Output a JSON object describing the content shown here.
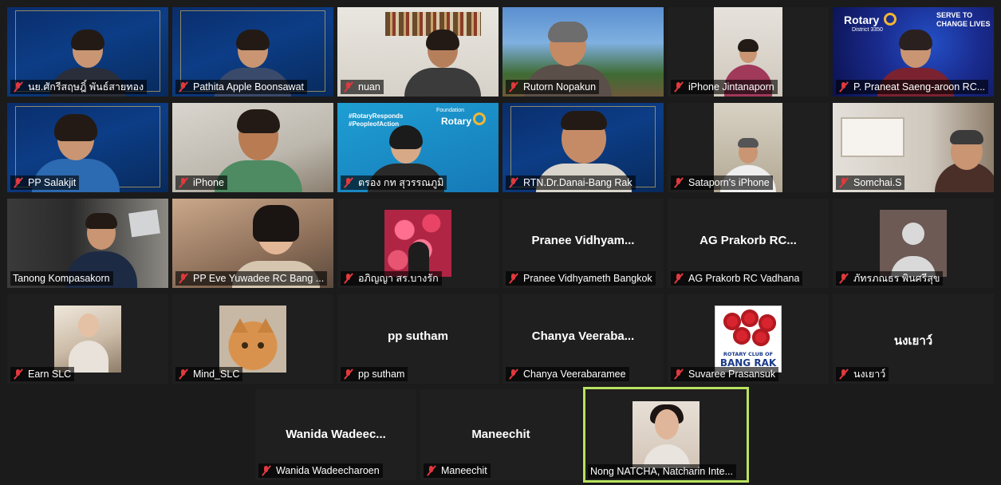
{
  "tiles": [
    {
      "name": "นย.ศักรีสฤษฎิ์ พันธ์สายทอง",
      "muted": true
    },
    {
      "name": "Pathita Apple Boonsawat",
      "muted": true
    },
    {
      "name": "nuan",
      "muted": true
    },
    {
      "name": "Rutorn Nopakun",
      "muted": true
    },
    {
      "name": "iPhone Jintanaporn",
      "muted": true
    },
    {
      "name": "P. Praneat Saeng-aroon RC...",
      "muted": true
    },
    {
      "name": "PP Salakjit",
      "muted": true
    },
    {
      "name": "iPhone",
      "muted": true
    },
    {
      "name": "ตรอง กท สุวรรณภูมิ",
      "muted": true
    },
    {
      "name": "RTN.Dr.Danai-Bang Rak",
      "muted": true
    },
    {
      "name": "Sataporn's iPhone",
      "muted": true
    },
    {
      "name": "Somchai.S",
      "muted": true
    },
    {
      "name": "Tanong Kompasakorn",
      "muted": false
    },
    {
      "name": "PP Eve Yuwadee RC Bang ...",
      "muted": true
    },
    {
      "name": "อภิญญา สร.บางรัก",
      "muted": true
    },
    {
      "name": "Pranee Vidhyameth Bangkok",
      "muted": true,
      "center": "Pranee  Vidhyam..."
    },
    {
      "name": "AG Prakorb RC Vadhana",
      "muted": true,
      "center": "AG  Prakorb  RC..."
    },
    {
      "name": "ภัทรภณธร พินศรีสุข",
      "muted": true
    },
    {
      "name": "Earn SLC",
      "muted": true
    },
    {
      "name": "Mind_SLC",
      "muted": true
    },
    {
      "name": "pp sutham",
      "muted": true,
      "center": "pp sutham"
    },
    {
      "name": "Chanya Veerabaramee",
      "muted": true,
      "center": "Chanya  Veeraba..."
    },
    {
      "name": "Suvaree Prasansuk",
      "muted": true
    },
    {
      "name": "นงเยาว์",
      "muted": true,
      "center": "นงเยาว์"
    },
    {
      "name": "Wanida Wadeecharoen",
      "muted": true,
      "center": "Wanida  Wadeec..."
    },
    {
      "name": "Maneechit",
      "muted": true,
      "center": "Maneechit"
    },
    {
      "name": "Nong NATCHA, Natcharin Inte...",
      "muted": false
    }
  ],
  "overlays": {
    "rotary_brand": "Rotary",
    "district": "District 3350",
    "serve_line1": "SERVE TO",
    "serve_line2": "CHANGE LIVES",
    "rotary_responds": "#RotaryResponds",
    "people_action": "#PeopleofAction",
    "rotary_foundation": "Rotary",
    "foundation_sub": "Foundation",
    "logo_line1": "ROTARY CLUB OF",
    "logo_line2": "BANG RAK"
  },
  "colors": {
    "active_border": "#b9e25f",
    "muted_icon": "#e0393e",
    "background": "#1b1b1b"
  }
}
